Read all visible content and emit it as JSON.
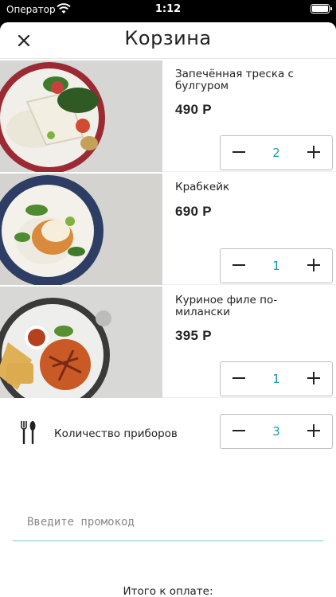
{
  "status_bar": {
    "carrier": "Оператор",
    "time": "1:12"
  },
  "header": {
    "title": "Корзина"
  },
  "cart": {
    "items": [
      {
        "name": "Запечённая треска с булгуром",
        "price": "490 Р",
        "quantity": "2"
      },
      {
        "name": "Крабкейк",
        "price": "690 Р",
        "quantity": "1"
      },
      {
        "name": "Куриное филе по-милански",
        "price": "395 Р",
        "quantity": "1"
      }
    ]
  },
  "cutlery": {
    "label": "Количество приборов",
    "quantity": "3"
  },
  "promo": {
    "placeholder": "Введите промокод",
    "value": ""
  },
  "summary": {
    "total_label": "Итого к оплате:"
  },
  "colors": {
    "accent": "#1b9aaa"
  }
}
